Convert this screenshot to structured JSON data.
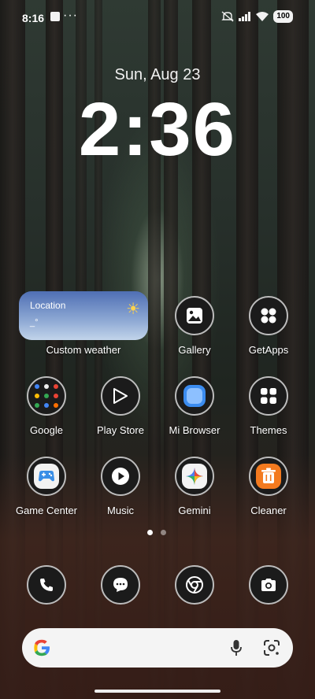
{
  "status_bar": {
    "time": "8:16",
    "notification_dots": "···",
    "battery": "100"
  },
  "lockclock": {
    "date": "Sun, Aug 23",
    "time": "2:36"
  },
  "weather_widget": {
    "location": "Location",
    "value": "_°",
    "label": "Custom weather"
  },
  "apps": [
    {
      "label": "Gallery"
    },
    {
      "label": "GetApps"
    },
    {
      "label": "Google"
    },
    {
      "label": "Play Store"
    },
    {
      "label": "Mi Browser"
    },
    {
      "label": "Themes"
    },
    {
      "label": "Game Center"
    },
    {
      "label": "Music"
    },
    {
      "label": "Gemini"
    },
    {
      "label": "Cleaner"
    }
  ],
  "dock": [
    {
      "icon": "phone-icon"
    },
    {
      "icon": "messages-icon"
    },
    {
      "icon": "chrome-icon"
    },
    {
      "icon": "camera-icon"
    }
  ],
  "search_bar": {
    "logo": "google-g-icon",
    "mic": "mic-icon",
    "lens": "lens-icon"
  },
  "colors": {
    "cleaner_orange": "#f37a1f",
    "browser_blue": "#3b8cf0",
    "widget_blue": "#4f6fb4"
  }
}
